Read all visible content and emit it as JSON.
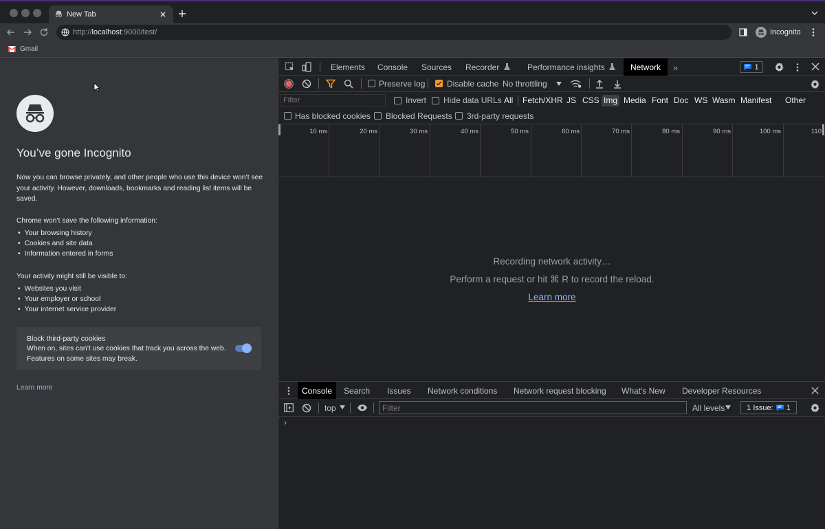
{
  "browser": {
    "tab_title": "New Tab",
    "url_prefix": "http://",
    "url_host": "localhost",
    "url_rest": ":9000/test/",
    "profile_label": "Incognito",
    "bookmark": "Gmail"
  },
  "incognito": {
    "heading": "You’ve gone Incognito",
    "intro": "Now you can browse privately, and other people who use this device won’t see your activity. However, downloads, bookmarks and reading list items will be saved.",
    "wont_save_heading": "Chrome won’t save the following information:",
    "wont_save_items": [
      "Your browsing history",
      "Cookies and site data",
      "Information entered in forms"
    ],
    "visible_heading": "Your activity might still be visible to:",
    "visible_items": [
      "Websites you visit",
      "Your employer or school",
      "Your internet service provider"
    ],
    "cookie_title": "Block third-party cookies",
    "cookie_desc": "When on, sites can’t use cookies that track you across the web. Features on some sites may break.",
    "learn_more": "Learn more"
  },
  "devtools": {
    "tabs": [
      "Elements",
      "Console",
      "Sources",
      "Recorder",
      "Performance insights",
      "Network"
    ],
    "active_tab": "Network",
    "issue_count": "1",
    "netbar": {
      "preserve_log": "Preserve log",
      "disable_cache": "Disable cache",
      "throttling": "No throttling"
    },
    "filter": {
      "placeholder": "Filter",
      "invert": "Invert",
      "hide_data_urls": "Hide data URLs",
      "types": [
        "All",
        "Fetch/XHR",
        "JS",
        "CSS",
        "Img",
        "Media",
        "Font",
        "Doc",
        "WS",
        "Wasm",
        "Manifest",
        "Other"
      ],
      "selected_type": "Img",
      "blocked_cookies": "Has blocked cookies",
      "blocked_requests": "Blocked Requests",
      "third_party": "3rd-party requests"
    },
    "timeline_ticks": [
      "10 ms",
      "20 ms",
      "30 ms",
      "40 ms",
      "50 ms",
      "60 ms",
      "70 ms",
      "80 ms",
      "90 ms",
      "100 ms",
      "110"
    ],
    "empty": {
      "line1": "Recording network activity…",
      "line2": "Perform a request or hit ⌘ R to record the reload.",
      "link": "Learn more"
    },
    "drawer": {
      "tabs": [
        "Console",
        "Search",
        "Issues",
        "Network conditions",
        "Network request blocking",
        "What's New",
        "Developer Resources"
      ],
      "active_tab": "Console",
      "context": "top",
      "filter_placeholder": "Filter",
      "levels": "All levels",
      "issues_label": "1 Issue:",
      "issues_count": "1",
      "prompt": "›"
    }
  },
  "colors": {
    "accent_blue": "#8ab4f8",
    "record_red": "#f25d5d",
    "filter_orange": "#f39a2e",
    "checkbox_orange": "#f39a2e"
  }
}
